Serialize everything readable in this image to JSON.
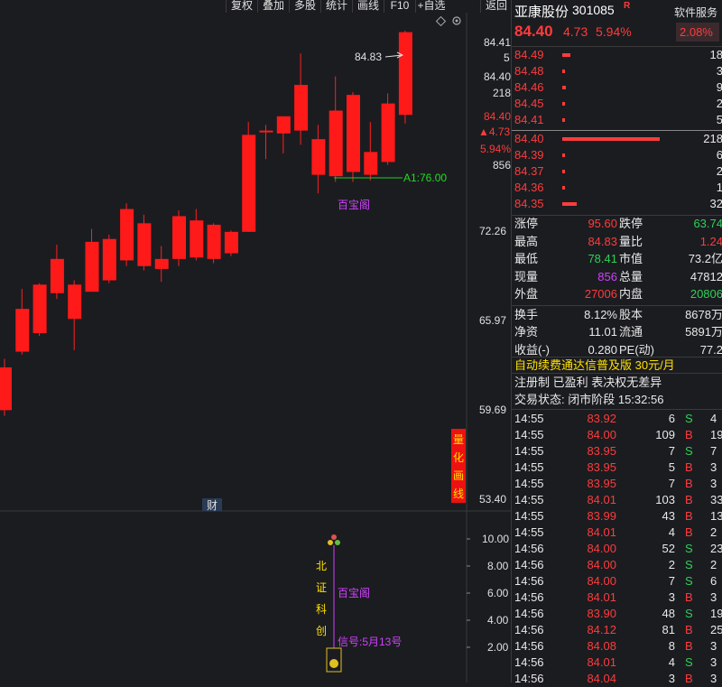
{
  "toolbar": {
    "items": [
      "复权",
      "叠加",
      "多股",
      "统计",
      "画线",
      "F10",
      "+自选",
      "返回"
    ]
  },
  "chart": {
    "price_labels": [
      "84.41",
      "5",
      "84.40",
      "218",
      "84.40",
      "▲4.73",
      "5.94%",
      "856",
      "72.26",
      "65.97",
      "59.69",
      "53.40"
    ],
    "high_marker": "84.83",
    "a1_label": "A1:76.00",
    "baibaoge": "百宝阁",
    "quant_vertical": "量化画线",
    "cai_label": "财",
    "sub_labels": [
      "10.00",
      "8.00",
      "6.00",
      "4.00",
      "2.00"
    ],
    "beizheng_vertical": "北证科创",
    "sub_baibaoge": "百宝阁",
    "signal_text": "信号:5月13号"
  },
  "header": {
    "name": "亚康股份",
    "code": "301085",
    "r_badge": "R",
    "price": "84.40",
    "change": "4.73",
    "pct": "5.94%",
    "industry": "软件服务",
    "industry_pct": "2.08%"
  },
  "orderbook": {
    "asks": [
      {
        "p": "84.49",
        "v": "18"
      },
      {
        "p": "84.48",
        "v": "3"
      },
      {
        "p": "84.46",
        "v": "9"
      },
      {
        "p": "84.45",
        "v": "2"
      },
      {
        "p": "84.41",
        "v": "5"
      }
    ],
    "bids": [
      {
        "p": "84.40",
        "v": "218"
      },
      {
        "p": "84.39",
        "v": "6"
      },
      {
        "p": "84.37",
        "v": "2"
      },
      {
        "p": "84.36",
        "v": "1"
      },
      {
        "p": "84.35",
        "v": "32"
      }
    ]
  },
  "stats": {
    "zhangting_l": "涨停",
    "zhangting_v": "95.60",
    "dieting_l": "跌停",
    "dieting_v": "63.74",
    "high_l": "最高",
    "high_v": "84.83",
    "liangbi_l": "量比",
    "liangbi_v": "1.24",
    "low_l": "最低",
    "low_v": "78.41",
    "shizhi_l": "市值",
    "shizhi_v": "73.2亿",
    "xianliang_l": "现量",
    "xianliang_v": "856",
    "zongliang_l": "总量",
    "zongliang_v": "47812",
    "waipan_l": "外盘",
    "waipan_v": "27006",
    "neipan_l": "内盘",
    "neipan_v": "20806",
    "huanshou_l": "换手",
    "huanshou_v": "8.12%",
    "guben_l": "股本",
    "guben_v": "8678万",
    "jingzi_l": "净资",
    "jingzi_v": "11.01",
    "liutong_l": "流通",
    "liutong_v": "5891万",
    "shouyi_l": "收益(-)",
    "shouyi_v": "0.280",
    "pe_l": "PE(动)",
    "pe_v": "77.2"
  },
  "promo": "自动续费通达信普及版  30元/月",
  "reg_info": "注册制 已盈利 表决权无差异",
  "status_line": "交易状态: 闭市阶段 15:32:56",
  "ticks": [
    {
      "t": "14:55",
      "p": "83.92",
      "v": "6",
      "bs": "S",
      "n": "4"
    },
    {
      "t": "14:55",
      "p": "84.00",
      "v": "109",
      "bs": "B",
      "n": "19"
    },
    {
      "t": "14:55",
      "p": "83.95",
      "v": "7",
      "bs": "S",
      "n": "7"
    },
    {
      "t": "14:55",
      "p": "83.95",
      "v": "5",
      "bs": "B",
      "n": "3"
    },
    {
      "t": "14:55",
      "p": "83.95",
      "v": "7",
      "bs": "B",
      "n": "3"
    },
    {
      "t": "14:55",
      "p": "84.01",
      "v": "103",
      "bs": "B",
      "n": "33"
    },
    {
      "t": "14:55",
      "p": "83.99",
      "v": "43",
      "bs": "B",
      "n": "13"
    },
    {
      "t": "14:55",
      "p": "84.01",
      "v": "4",
      "bs": "B",
      "n": "2"
    },
    {
      "t": "14:56",
      "p": "84.00",
      "v": "52",
      "bs": "S",
      "n": "23"
    },
    {
      "t": "14:56",
      "p": "84.00",
      "v": "2",
      "bs": "S",
      "n": "2"
    },
    {
      "t": "14:56",
      "p": "84.00",
      "v": "7",
      "bs": "S",
      "n": "6"
    },
    {
      "t": "14:56",
      "p": "84.01",
      "v": "3",
      "bs": "B",
      "n": "3"
    },
    {
      "t": "14:56",
      "p": "83.90",
      "v": "48",
      "bs": "S",
      "n": "19"
    },
    {
      "t": "14:56",
      "p": "84.12",
      "v": "81",
      "bs": "B",
      "n": "25"
    },
    {
      "t": "14:56",
      "p": "84.08",
      "v": "8",
      "bs": "B",
      "n": "3"
    },
    {
      "t": "14:56",
      "p": "84.01",
      "v": "4",
      "bs": "S",
      "n": "3"
    },
    {
      "t": "14:56",
      "p": "84.04",
      "v": "3",
      "bs": "B",
      "n": "3"
    }
  ],
  "candles": [
    {
      "o": 60.0,
      "c": 63.0,
      "h": 63.6,
      "l": 59.6
    },
    {
      "o": 64.1,
      "c": 67.1,
      "h": 68.5,
      "l": 63.9
    },
    {
      "o": 65.4,
      "c": 68.8,
      "h": 68.9,
      "l": 65.2
    },
    {
      "o": 68.2,
      "c": 70.6,
      "h": 71.6,
      "l": 67.8
    },
    {
      "o": 66.4,
      "c": 68.8,
      "h": 69.1,
      "l": 64.2
    },
    {
      "o": 68.3,
      "c": 71.8,
      "h": 72.7,
      "l": 68.3
    },
    {
      "o": 69.1,
      "c": 72.0,
      "h": 72.3,
      "l": 68.9
    },
    {
      "o": 70.5,
      "c": 74.1,
      "h": 74.5,
      "l": 70.1
    },
    {
      "o": 70.1,
      "c": 73.1,
      "h": 73.7,
      "l": 69.8
    },
    {
      "o": 69.9,
      "c": 70.6,
      "h": 71.5,
      "l": 69.0
    },
    {
      "o": 70.6,
      "c": 73.6,
      "h": 74.0,
      "l": 70.1
    },
    {
      "o": 70.7,
      "c": 73.3,
      "h": 74.1,
      "l": 70.5
    },
    {
      "o": 70.6,
      "c": 73.0,
      "h": 73.1,
      "l": 70.3
    },
    {
      "o": 71.0,
      "c": 72.5,
      "h": 72.6,
      "l": 70.8
    },
    {
      "o": 72.5,
      "c": 79.3,
      "h": 80.2,
      "l": 72.5
    },
    {
      "o": 79.6,
      "c": 79.6,
      "h": 80.0,
      "l": 77.6
    },
    {
      "o": 79.4,
      "c": 80.6,
      "h": 80.6,
      "l": 78.0
    },
    {
      "o": 79.6,
      "c": 82.8,
      "h": 85.0,
      "l": 78.6
    },
    {
      "o": 76.5,
      "c": 79.0,
      "h": 80.0,
      "l": 75.2
    },
    {
      "o": 76.4,
      "c": 81.0,
      "h": 83.4,
      "l": 76.0
    },
    {
      "o": 76.7,
      "c": 82.1,
      "h": 82.3,
      "l": 76.0
    },
    {
      "o": 76.5,
      "c": 78.1,
      "h": 80.2,
      "l": 76.1
    },
    {
      "o": 77.4,
      "c": 81.5,
      "h": 82.2,
      "l": 77.2
    },
    {
      "o": 80.7,
      "c": 86.5,
      "h": 86.6,
      "l": 80.1
    }
  ]
}
